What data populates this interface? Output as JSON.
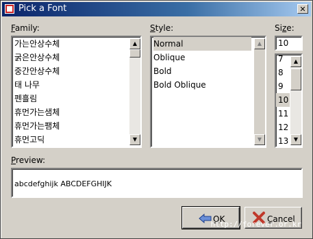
{
  "window": {
    "title": "Pick a Font"
  },
  "family": {
    "label_underline": "F",
    "label_rest": "amily:",
    "items": [
      "가는안상수체",
      "굵은안상수체",
      "중간안상수체",
      "태 나무",
      "펜흘림",
      "휴먼가는샘체",
      "휴먼가는팸체",
      "휴먼고딕"
    ]
  },
  "style": {
    "label_underline": "S",
    "label_rest": "tyle:",
    "items": [
      "Normal",
      "Oblique",
      "Bold",
      "Bold Oblique"
    ],
    "selected": "Normal"
  },
  "size": {
    "label_prefix": "Si",
    "label_underline": "z",
    "label_rest": "e:",
    "value": "10",
    "items": [
      "7",
      "8",
      "9",
      "10",
      "11",
      "12",
      "13"
    ],
    "selected": "10"
  },
  "preview": {
    "label_underline": "P",
    "label_rest": "review:",
    "text": "abcdefghijk ABCDEFGHIJK"
  },
  "buttons": {
    "ok_underline": "O",
    "ok_rest": "K",
    "cancel_underline": "C",
    "cancel_rest": "ancel"
  },
  "watermark": "http://forever.or.kr",
  "colors": {
    "titlebar_start": "#0a246a",
    "titlebar_end": "#a6caf0",
    "face": "#d4d0c8"
  }
}
